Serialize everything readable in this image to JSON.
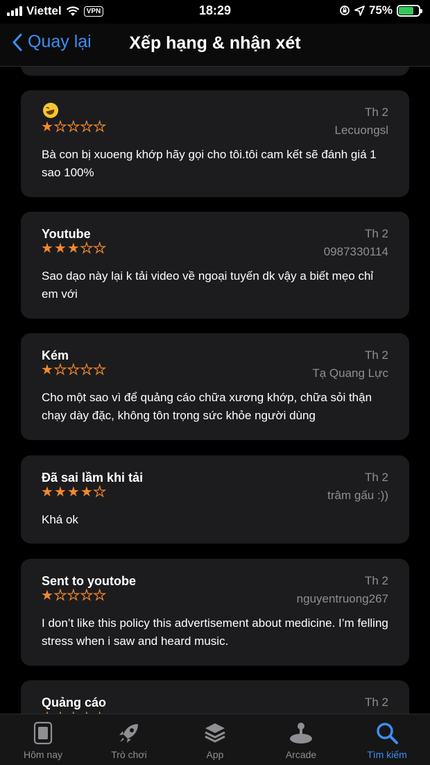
{
  "status_bar": {
    "carrier": "Viettel",
    "vpn": "VPN",
    "time": "18:29",
    "battery": "75%"
  },
  "nav": {
    "back_label": "Quay lại",
    "title": "Xếp hạng & nhận xét"
  },
  "reviews": [
    {
      "title": "",
      "has_emoji": true,
      "date": "Th 2",
      "author": "Lecuongsl",
      "rating": 1,
      "body": "Bà con bị xuoeng khớp hãy gọi cho tôi.tôi cam kết sẽ đánh giá 1 sao 100%"
    },
    {
      "title": "Youtube",
      "date": "Th 2",
      "author": "0987330114",
      "rating": 3,
      "body": "Sao dạo này lại k tải video về ngoại tuyến dk vậy a biết mẹo chỉ em với"
    },
    {
      "title": "Kém",
      "date": "Th 2",
      "author": "Tạ Quang Lực",
      "rating": 1,
      "body": "Cho một sao vì để quảng cáo chữa xương khớp, chữa sỏi thận chạy dày đặc, không tôn trọng sức khỏe người dùng"
    },
    {
      "title": "Đã sai lầm khi tải",
      "date": "Th 2",
      "author": "trâm gấu :))",
      "rating": 4,
      "body": "Khá ok"
    },
    {
      "title": "Sent to youtobe",
      "date": "Th 2",
      "author": "nguyentruong267",
      "rating": 1,
      "body": "I don’t like this policy this advertisement about medicine. I’m felling stress when i saw and heard music."
    },
    {
      "title": "Quảng cáo",
      "date": "Th 2",
      "author": "",
      "rating": 5,
      "body": ""
    }
  ],
  "tab_bar": {
    "items": [
      {
        "label": "Hôm nay",
        "icon": "today-icon"
      },
      {
        "label": "Trò chơi",
        "icon": "rocket-icon"
      },
      {
        "label": "App",
        "icon": "layers-icon"
      },
      {
        "label": "Arcade",
        "icon": "joystick-icon"
      },
      {
        "label": "Tìm kiếm",
        "icon": "search-icon"
      }
    ],
    "active_index": 4
  },
  "colors": {
    "accent": "#3d8ef7",
    "star": "#f5892b",
    "card_bg": "#1c1c1e",
    "secondary_text": "#8e8e93"
  }
}
